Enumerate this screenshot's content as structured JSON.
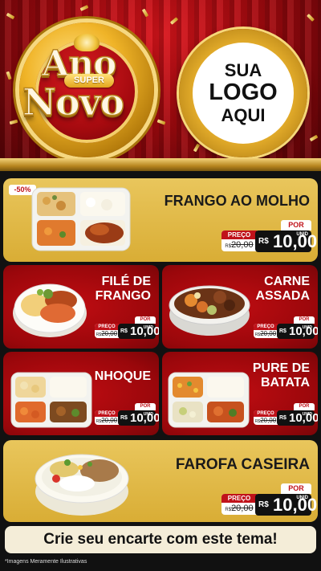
{
  "hero": {
    "title_top": "Ano",
    "title_badge": "SUPER",
    "title_bottom": "Novo",
    "logo_line1": "SUA",
    "logo_line2": "LOGO",
    "logo_line3": "AQUI"
  },
  "currency": "R$",
  "price_label": "PREÇO",
  "por_label": "POR",
  "unit_label": "UNID",
  "items": [
    {
      "name": "FRANGO AO MOLHO",
      "badge": "-50%",
      "old_prefix": "R$",
      "old_price": "20,00",
      "price": "10,00"
    },
    {
      "name_line1": "FILÉ DE",
      "name_line2": "FRANGO",
      "old_prefix": "R$",
      "old_price": "20,00",
      "price": "10,00"
    },
    {
      "name_line1": "CARNE",
      "name_line2": "ASSADA",
      "old_prefix": "R$",
      "old_price": "20,00",
      "price": "10,00"
    },
    {
      "name": "NHOQUE",
      "old_prefix": "R$",
      "old_price": "20,00",
      "price": "10,00"
    },
    {
      "name_line1": "PURE DE",
      "name_line2": "BATATA",
      "old_prefix": "R$",
      "old_price": "20,00",
      "price": "10,00"
    },
    {
      "name": "FAROFA CASEIRA",
      "old_prefix": "R$",
      "old_price": "20,00",
      "price": "10,00"
    }
  ],
  "footer": {
    "cta": "Crie seu encarte com este tema!",
    "disclaimer": "*Imagens Meramente Ilustrativas"
  },
  "colors": {
    "red": "#c0121a",
    "gold": "#e9c65c",
    "dark": "#111111"
  }
}
